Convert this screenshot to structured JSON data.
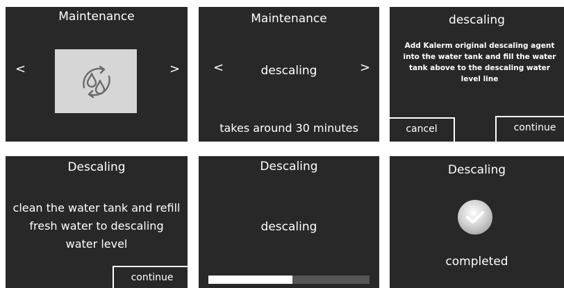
{
  "screens": [
    {
      "title": "Maintenance",
      "prev": "<",
      "next": ">",
      "icon": "descaling-drops-icon"
    },
    {
      "title": "Maintenance",
      "prev": "<",
      "next": ">",
      "label": "descaling",
      "footer": "takes around 30 minutes"
    },
    {
      "title": "descaling",
      "message": "Add Kalerm original descaling agent into the water tank and fill the water tank above to the descaling water level line",
      "cancel": "cancel",
      "continue": "continue"
    },
    {
      "title": "Descaling",
      "message": "clean the water tank and refill fresh water to descaling water level",
      "continue": "continue"
    },
    {
      "title": "Descaling",
      "label": "descaling",
      "progress": 0.52
    },
    {
      "title": "Descaling",
      "status": "completed",
      "icon": "check-icon"
    }
  ]
}
